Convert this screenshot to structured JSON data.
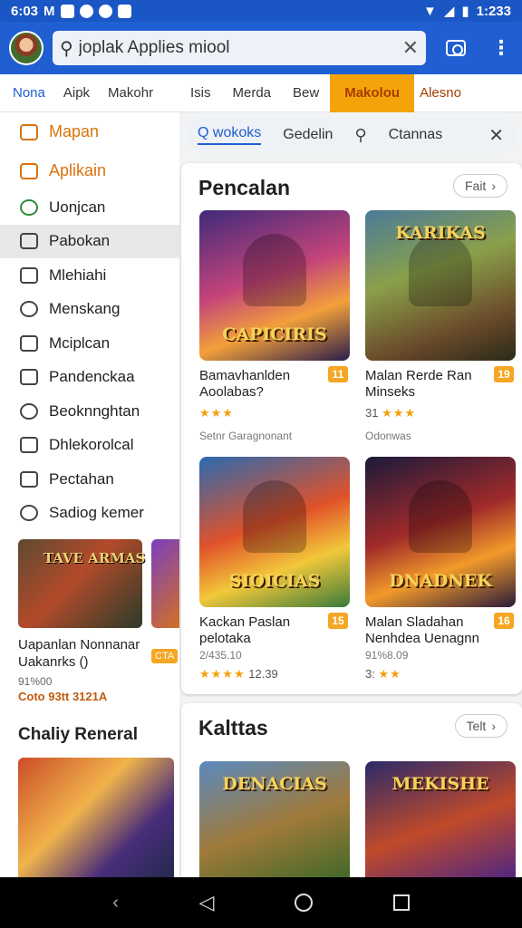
{
  "status": {
    "time": "6:03",
    "letter": "M",
    "clock": "1:233"
  },
  "search": {
    "value": "joplak Applies miool"
  },
  "left_tabs": [
    "Nona",
    "Aipk",
    "Makohr"
  ],
  "nav_items": [
    {
      "label": "Mapan",
      "style": "orange"
    },
    {
      "label": "Aplikain",
      "style": "orange"
    },
    {
      "label": "Uonjcan",
      "style": "green"
    },
    {
      "label": "Pabokan",
      "style": "active"
    },
    {
      "label": "Mlehiahi",
      "style": ""
    },
    {
      "label": "Menskang",
      "style": ""
    },
    {
      "label": "Mciplcan",
      "style": ""
    },
    {
      "label": "Pandenckaa",
      "style": ""
    },
    {
      "label": "Beoknnghtan",
      "style": ""
    },
    {
      "label": "Dhlekorolcal",
      "style": ""
    },
    {
      "label": "Pectahan",
      "style": ""
    },
    {
      "label": "Sadiog kemer",
      "style": ""
    }
  ],
  "promo": {
    "art_title": "TAVE ARMAS",
    "title": "Uapanlan Nonnanar Uakanrks ()",
    "badge": "CTA",
    "meta1": "91%00",
    "meta2": "Coto 93tt 3121A"
  },
  "left_section_title": "Chaliy Reneral",
  "right_tabs": [
    "Isis",
    "Merda",
    "Bew"
  ],
  "right_tabs_active": [
    "Makolou",
    "Alesno"
  ],
  "right_gear": "⬦",
  "filters": {
    "active": "Q wokoks",
    "items": [
      "Gedelin"
    ],
    "last": "Ctannas"
  },
  "card1": {
    "title": "Pencalan",
    "more": "Fait",
    "games": [
      {
        "name": "Bamavhanlden Aoolabas?",
        "art_title": "CAPICIRIS",
        "badge": "11",
        "stars": "★★★",
        "rating": "",
        "meta": "Setnr Garagnonant"
      },
      {
        "name": "Malan Rerde Ran Minseks",
        "art_title": "KARIKAS",
        "badge": "19",
        "stars": "★★★",
        "rating": "31",
        "meta": "Odonwas"
      },
      {
        "name": "Kackan Paslan pelotaka",
        "art_title": "SIOICIAS",
        "badge": "15",
        "stars": "★★★★",
        "rating": "12.39",
        "meta": "2/435.10"
      },
      {
        "name": "Malan Sladahan Nenhdea Uenagnn",
        "art_title": "DNADNEK",
        "badge": "16",
        "stars": "★★",
        "rating": "3:",
        "meta": "91%8.09"
      }
    ]
  },
  "card2": {
    "title": "Kalttas",
    "more": "Telt",
    "games": [
      {
        "art_title": "DENACIAS"
      },
      {
        "art_title": "MEKISHE"
      }
    ]
  }
}
